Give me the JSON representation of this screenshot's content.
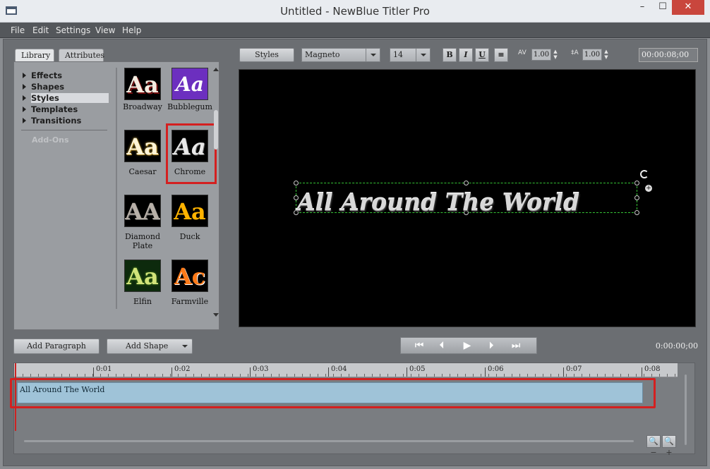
{
  "window": {
    "title": "Untitled - NewBlue Titler Pro",
    "minimize": "–",
    "maximize": "☐",
    "close": "✕"
  },
  "menu": [
    "File",
    "Edit",
    "Settings",
    "View",
    "Help"
  ],
  "tabs": {
    "library": "Library",
    "attributes": "Attributes"
  },
  "tree": {
    "items": [
      "Effects",
      "Shapes",
      "Styles",
      "Templates",
      "Transitions"
    ],
    "selected": "Styles",
    "addons": "Add-Ons"
  },
  "styles": [
    {
      "name": "Broadway",
      "glyph": "Aa",
      "color": "#f4ece0"
    },
    {
      "name": "Bubblegum",
      "glyph": "Aa",
      "color": "#ffffff"
    },
    {
      "name": "Caesar",
      "glyph": "Aa",
      "color": "#fff5d8"
    },
    {
      "name": "Chrome",
      "glyph": "Aa",
      "color": "#e8e8e8"
    },
    {
      "name": "Diamond Plate",
      "glyph": "AA",
      "color": "#b8b0a8"
    },
    {
      "name": "Duck",
      "glyph": "Aa",
      "color": "#ffb300"
    },
    {
      "name": "Elfin",
      "glyph": "Aa",
      "color": "#d2e47a"
    },
    {
      "name": "Farmville",
      "glyph": "Ac",
      "color": "#ff7a18"
    }
  ],
  "toolbar": {
    "styles_button": "Styles",
    "font": "Magneto",
    "size": "14",
    "bold": "B",
    "italic": "I",
    "underline": "U",
    "align": "≡",
    "tracking_label": "AV",
    "tracking": "1.00",
    "leading_label": "‡A",
    "leading": "1.00",
    "duration": "00:00:08;00"
  },
  "preview": {
    "text": "All Around The World"
  },
  "lower": {
    "add_paragraph": "Add Paragraph",
    "add_shape": "Add Shape",
    "current_time": "0:00:00;00",
    "transport": [
      "⏮",
      "⏴",
      "▶",
      "⏵",
      "⏭"
    ]
  },
  "timeline": {
    "ticks": [
      "0:01",
      "0:02",
      "0:03",
      "0:04",
      "0:05",
      "0:06",
      "0:07",
      "0:08"
    ],
    "clip_label": "All Around The World",
    "zoom_out": "🔍−",
    "zoom_in": "🔍+"
  },
  "colors": {
    "highlight": "#d42020",
    "clip": "#9fc3d8",
    "selection": "#35c435"
  }
}
